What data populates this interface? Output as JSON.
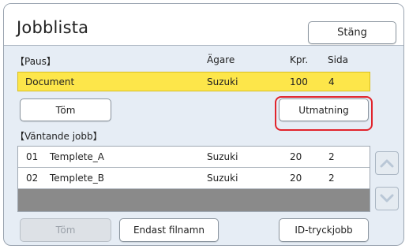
{
  "header": {
    "title": "Jobblista",
    "close_label": "Stäng"
  },
  "paused": {
    "section_label": "【Paus】",
    "columns": {
      "owner": "Ägare",
      "copies": "Kpr.",
      "page": "Sida"
    },
    "job": {
      "name": "Document",
      "owner": "Suzuki",
      "copies": "100",
      "page": "4"
    }
  },
  "actions": {
    "clear_label": "Töm",
    "eject_label": "Utmatning"
  },
  "waiting": {
    "section_label": "【Väntande jobb】",
    "jobs": [
      {
        "no": "01",
        "name": "Templete_A",
        "owner": "Suzuki",
        "copies": "20",
        "page": "2"
      },
      {
        "no": "02",
        "name": "Templete_B",
        "owner": "Suzuki",
        "copies": "20",
        "page": "2"
      }
    ]
  },
  "footer": {
    "clear_label": "Töm",
    "filename_only_label": "Endast filnamn",
    "id_print_label": "ID-tryckjobb"
  },
  "colors": {
    "highlight_row": "#fde64a",
    "eject_outline": "#e1242c",
    "empty_area": "#8a8a8a"
  },
  "icons": {
    "scroll_up": "chevron-up-icon",
    "scroll_down": "chevron-down-icon"
  }
}
